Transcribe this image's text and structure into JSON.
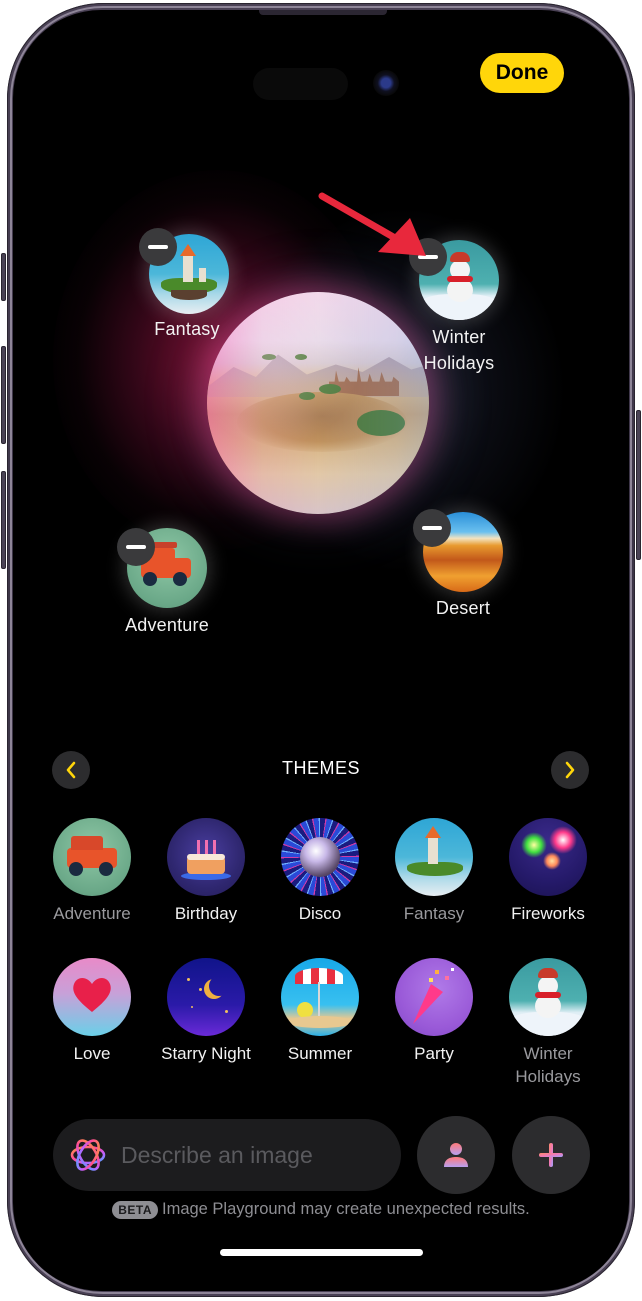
{
  "header": {
    "done_label": "Done"
  },
  "colors": {
    "accent_yellow": "#ffd60a",
    "annotation_red": "#e8283c",
    "button_gray": "#2c2c2e",
    "field_bg": "#1c1c1e"
  },
  "canvas": {
    "main_preview": "desert-landscape-preview",
    "selected_concepts": [
      {
        "label": "Fantasy",
        "icon": "castle-island-icon",
        "remove_icon": "minus-icon"
      },
      {
        "label": "Winter\nHolidays",
        "label_line1": "Winter",
        "label_line2": "Holidays",
        "icon": "snowman-icon",
        "remove_icon": "minus-icon"
      },
      {
        "label": "Adventure",
        "icon": "offroad-car-icon",
        "remove_icon": "minus-icon"
      },
      {
        "label": "Desert",
        "icon": "sand-dune-icon",
        "remove_icon": "minus-icon"
      }
    ],
    "annotation": "red-arrow-pointing-to-winter-holidays-remove-button"
  },
  "themes": {
    "title": "THEMES",
    "prev_icon": "chevron-left-icon",
    "next_icon": "chevron-right-icon",
    "items": [
      {
        "label": "Adventure",
        "selected": true,
        "icon": "offroad-car-icon"
      },
      {
        "label": "Birthday",
        "selected": false,
        "icon": "birthday-cake-icon"
      },
      {
        "label": "Disco",
        "selected": false,
        "icon": "disco-ball-icon"
      },
      {
        "label": "Fantasy",
        "selected": true,
        "icon": "castle-island-icon"
      },
      {
        "label": "Fireworks",
        "selected": false,
        "icon": "fireworks-icon"
      },
      {
        "label": "Love",
        "selected": false,
        "icon": "heart-balloon-icon"
      },
      {
        "label": "Starry Night",
        "selected": false,
        "icon": "moon-stars-icon"
      },
      {
        "label": "Summer",
        "selected": false,
        "icon": "beach-umbrella-icon"
      },
      {
        "label": "Party",
        "selected": false,
        "icon": "party-popper-icon"
      },
      {
        "label": "Winter Holidays",
        "label_line1": "Winter",
        "label_line2": "Holidays",
        "selected": true,
        "icon": "snowman-icon"
      }
    ]
  },
  "composer": {
    "placeholder": "Describe an image",
    "value": "",
    "person_button_icon": "person-icon",
    "add_button_icon": "plus-icon"
  },
  "footer": {
    "beta_badge": "BETA",
    "disclaimer": "Image Playground may create unexpected results."
  }
}
